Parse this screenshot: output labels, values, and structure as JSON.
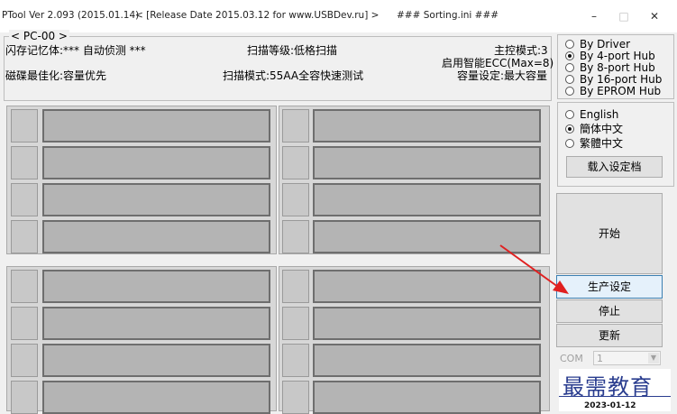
{
  "titlebar": {
    "app": "PTool Ver 2.093 (2015.01.14)",
    "release": "< [Release Date 2015.03.12 for www.USBDev.ru] >",
    "ini": "### Sorting.ini ###",
    "minimize": "–",
    "maximize": "□",
    "close": "✕"
  },
  "pc": {
    "legend": "< PC-00 >",
    "flash_memory": "闪存记忆体:*** 自动侦测 ***",
    "scan_level": "扫描等级:低格扫描",
    "controller_mode": "主控模式:3",
    "smart_ecc": "启用智能ECC(Max=8)",
    "disk_optimize": "磁碟最佳化:容量优先",
    "scan_mode": "扫描模式:55AA全容快速测试",
    "capacity_setting": "容量设定:最大容量"
  },
  "hub_options": [
    {
      "label": "By Driver",
      "selected": false
    },
    {
      "label": "By 4-port Hub",
      "selected": true
    },
    {
      "label": "By 8-port Hub",
      "selected": false
    },
    {
      "label": "By 16-port Hub",
      "selected": false
    },
    {
      "label": "By EPROM Hub",
      "selected": false
    }
  ],
  "language_options": [
    {
      "label": "English",
      "selected": false
    },
    {
      "label": "簡体中文",
      "selected": true
    },
    {
      "label": "繁體中文",
      "selected": false
    }
  ],
  "buttons": {
    "load_settings": "载入设定档",
    "start": "开始",
    "production_settings": "生产设定",
    "stop": "停止",
    "update": "更新"
  },
  "com": {
    "label": "COM",
    "value": "1"
  },
  "watermark": {
    "text": "最需教育",
    "date": "2023-01-12"
  },
  "annotation_color": "#e02020"
}
